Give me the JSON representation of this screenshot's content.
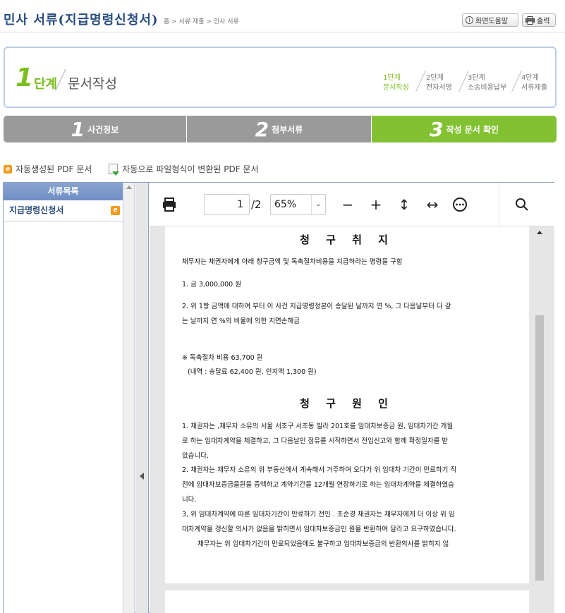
{
  "header": {
    "title": "민사 서류(지급명령신청서)",
    "breadcrumb": "홈 > 서류 제출 > 민사 서류",
    "help_label": "화면도움말",
    "print_label": "출력"
  },
  "step": {
    "number": "1",
    "unit": "단계",
    "title": "문서작성",
    "mini_steps": [
      {
        "num": "1단계",
        "label": "문서작성",
        "active": true
      },
      {
        "num": "2단계",
        "label": "전자서명",
        "active": false
      },
      {
        "num": "3단계",
        "label": "소송비용납부",
        "active": false
      },
      {
        "num": "4단계",
        "label": "서류제출",
        "active": false
      }
    ]
  },
  "tabs": [
    {
      "num": "1",
      "label": "사건정보"
    },
    {
      "num": "2",
      "label": "첨부서류"
    },
    {
      "num": "3",
      "label": "작성 문서 확인"
    }
  ],
  "legend": {
    "auto_pdf": "자동생성된 PDF 문서",
    "converted_pdf": "자동으로 파일형식이 변환된 PDF 문서"
  },
  "sidebar": {
    "header": "서류목록",
    "items": [
      {
        "label": "지급명령신청서"
      }
    ]
  },
  "viewer": {
    "current_page": "1",
    "total_pages": "/2",
    "zoom": "65%"
  },
  "document": {
    "heading1": "청 구 취 지",
    "p1": "채무자는 채권자에게 아래 청구금액 및 독촉절차비용을 지급하라는 명령을 구함",
    "p2": "1. 금 3,000,000 원",
    "p3a": "2. 위 1항 금액에 대하여  부터 이 사건 지급명령정본이 송달된 날까지 연 %, 그 다음날부터 다 갚",
    "p3b": "는 날까지 연 %의 비율에 의한 지연손해금",
    "p4": "※ 독촉절차 비용 63,700 원",
    "p5": "(내역 : 송달료 62,400 원, 인지액 1,300 원)",
    "heading2": "청 구 원 인",
    "c1a": "1. 채권자는 ,채무자 소유의 서울 서초구 서초동 빌라 201호를 임대차보증금 원, 임대차기간 개월",
    "c1b": "로 하는 임대차계약을 체결하고, 그 다음날인  점유를 시작하면서 전입신고와 함께 확정일자를 받",
    "c1c": "았습니다.",
    "c2a": "2. 채권자는 채무자 소유의 위 부동산에서 계속해서 거주하여 오다가 위 임대차 기간이 만료하기 직",
    "c2b": "전에 임대차보증금을원을 증액하고 계약기간을 12개월 연장하기로 하는 임대차계약을 체결하였습",
    "c2c": "니다.",
    "c3a": "3, 위 임대차계약에 따른 임대차기간이 만료하기 전인 . 초순경 채권자는 채무자에게 더 이상 위 임",
    "c3b": "대차계약을 갱신할 의사가 없음을 밝히면서 임대차보증금인 원을 반환하여 달라고 요구하였습니다.",
    "c4": "채무자는 위 임대차기간이 만료되었음에도 불구하고 임대차보증금의 반환의사를 밝히지 않"
  },
  "colors": {
    "accent_green": "#82c232",
    "title_blue": "#2a4d7f",
    "tab_gray": "#9a9a9a",
    "pdf_orange": "#f39b1d"
  },
  "icons": [
    "info-icon",
    "printer-icon",
    "pdf-icon",
    "converted-file-icon",
    "minus-icon",
    "plus-icon",
    "fit-height-icon",
    "fit-width-icon",
    "more-icon",
    "search-icon"
  ]
}
